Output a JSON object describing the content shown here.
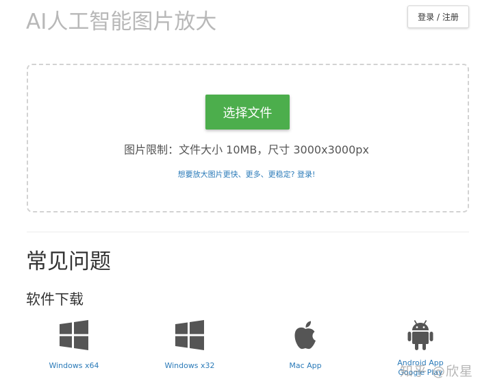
{
  "header": {
    "title": "AI人工智能图片放大",
    "login_label": "登录 / 注册"
  },
  "upload": {
    "choose_file_label": "选择文件",
    "limit_text": "图片限制：文件大小 10MB，尺寸 3000x3000px",
    "login_hint": "想要放大图片更快、更多、更稳定? 登录!"
  },
  "faq": {
    "title": "常见问题"
  },
  "downloads": {
    "title": "软件下载",
    "items": [
      {
        "label": "Windows x64",
        "icon": "windows-icon"
      },
      {
        "label": "Windows x32",
        "icon": "windows-icon"
      },
      {
        "label": "Mac App",
        "icon": "apple-icon"
      },
      {
        "label": "Android App",
        "label2": "Google Play",
        "icon": "android-icon"
      }
    ]
  },
  "watermark": "知乎 @欣星",
  "colors": {
    "accent_green": "#4cae4c",
    "link_blue": "#2a7ab8",
    "title_gray": "#b8b8b8",
    "icon_gray": "#555555"
  }
}
